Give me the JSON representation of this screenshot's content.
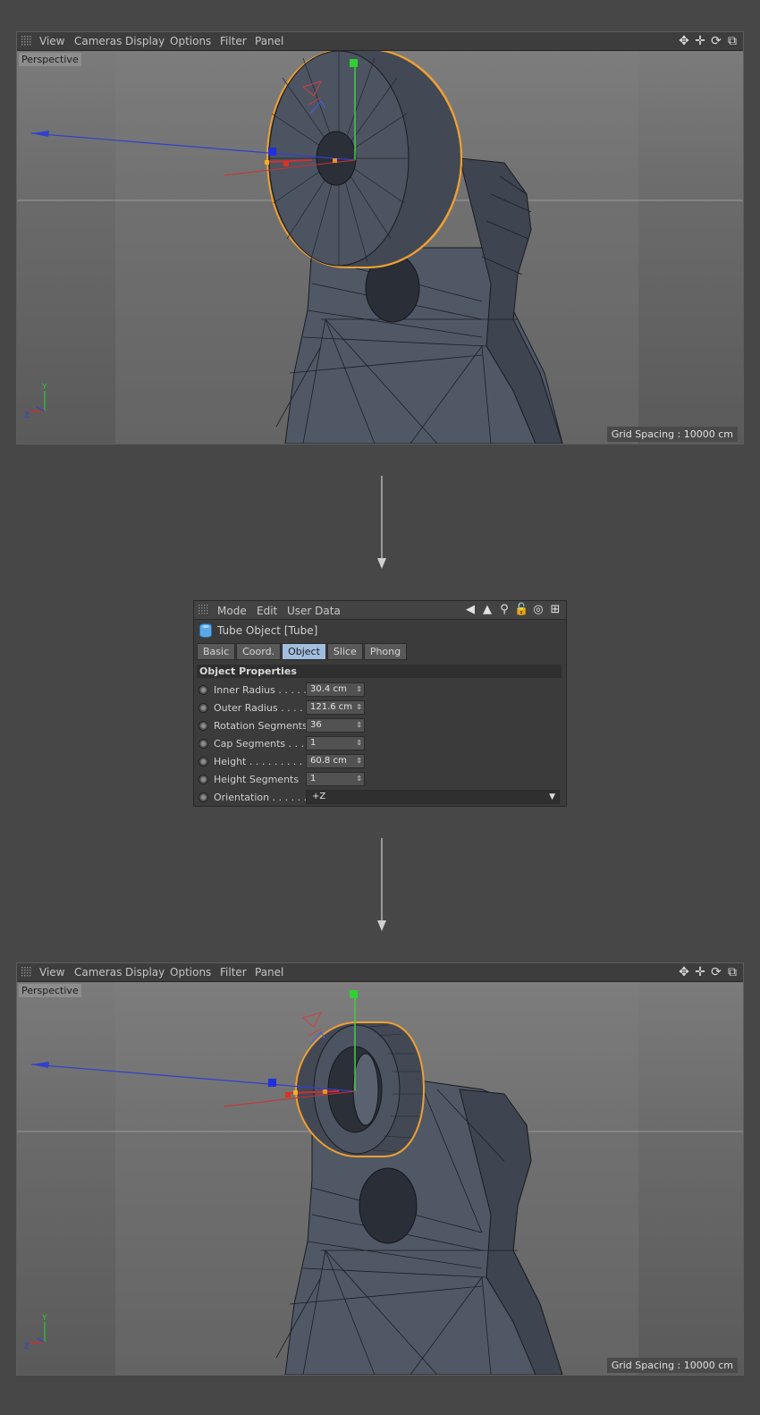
{
  "viewport_top": {
    "menu": [
      "View",
      "Cameras",
      "Display",
      "Options",
      "Filter",
      "Panel"
    ],
    "camera_label": "Perspective",
    "grid_spacing": "Grid Spacing : 10000 cm",
    "axis_labels": {
      "y": "Y",
      "z": "Z"
    }
  },
  "viewport_bottom": {
    "menu": [
      "View",
      "Cameras",
      "Display",
      "Options",
      "Filter",
      "Panel"
    ],
    "camera_label": "Perspective",
    "grid_spacing": "Grid Spacing : 10000 cm",
    "axis_labels": {
      "y": "Y",
      "z": "Z"
    }
  },
  "viewport_tools": [
    {
      "icon": "move-view-icon",
      "glyph": "✥"
    },
    {
      "icon": "dolly-view-icon",
      "glyph": "✛"
    },
    {
      "icon": "rotate-view-icon",
      "glyph": "⟳"
    },
    {
      "icon": "maximize-view-icon",
      "glyph": "⧉"
    }
  ],
  "attribute_manager": {
    "menu": [
      "Mode",
      "Edit",
      "User Data"
    ],
    "tools": [
      {
        "icon": "back-arrow-icon",
        "glyph": "◀"
      },
      {
        "icon": "up-arrow-icon",
        "glyph": "▲"
      },
      {
        "icon": "search-icon",
        "glyph": "⚲"
      },
      {
        "icon": "lock-icon",
        "glyph": "🔓"
      },
      {
        "icon": "target-icon",
        "glyph": "◎"
      },
      {
        "icon": "new-panel-icon",
        "glyph": "⊞"
      }
    ],
    "object_title": "Tube Object [Tube]",
    "tabs": [
      "Basic",
      "Coord.",
      "Object",
      "Slice",
      "Phong"
    ],
    "active_tab": "Object",
    "section_title": "Object Properties",
    "properties": [
      {
        "label": "Inner Radius . . . . .",
        "value": "30.4 cm"
      },
      {
        "label": "Outer Radius . . . . .",
        "value": "121.6 cm"
      },
      {
        "label": "Rotation Segments",
        "value": "36"
      },
      {
        "label": "Cap Segments . . . .",
        "value": "1"
      },
      {
        "label": "Height . . . . . . . . . .",
        "value": "60.8 cm"
      },
      {
        "label": "Height Segments",
        "value": "1"
      }
    ],
    "orientation": {
      "label": "Orientation . . . . . .",
      "value": "+Z"
    }
  },
  "colors": {
    "background": "#474747",
    "selection_outline": "#f0a030",
    "active_tab": "#a2bedf",
    "axis_x": "#d03030",
    "axis_y": "#30c040",
    "axis_z": "#3040d0"
  }
}
